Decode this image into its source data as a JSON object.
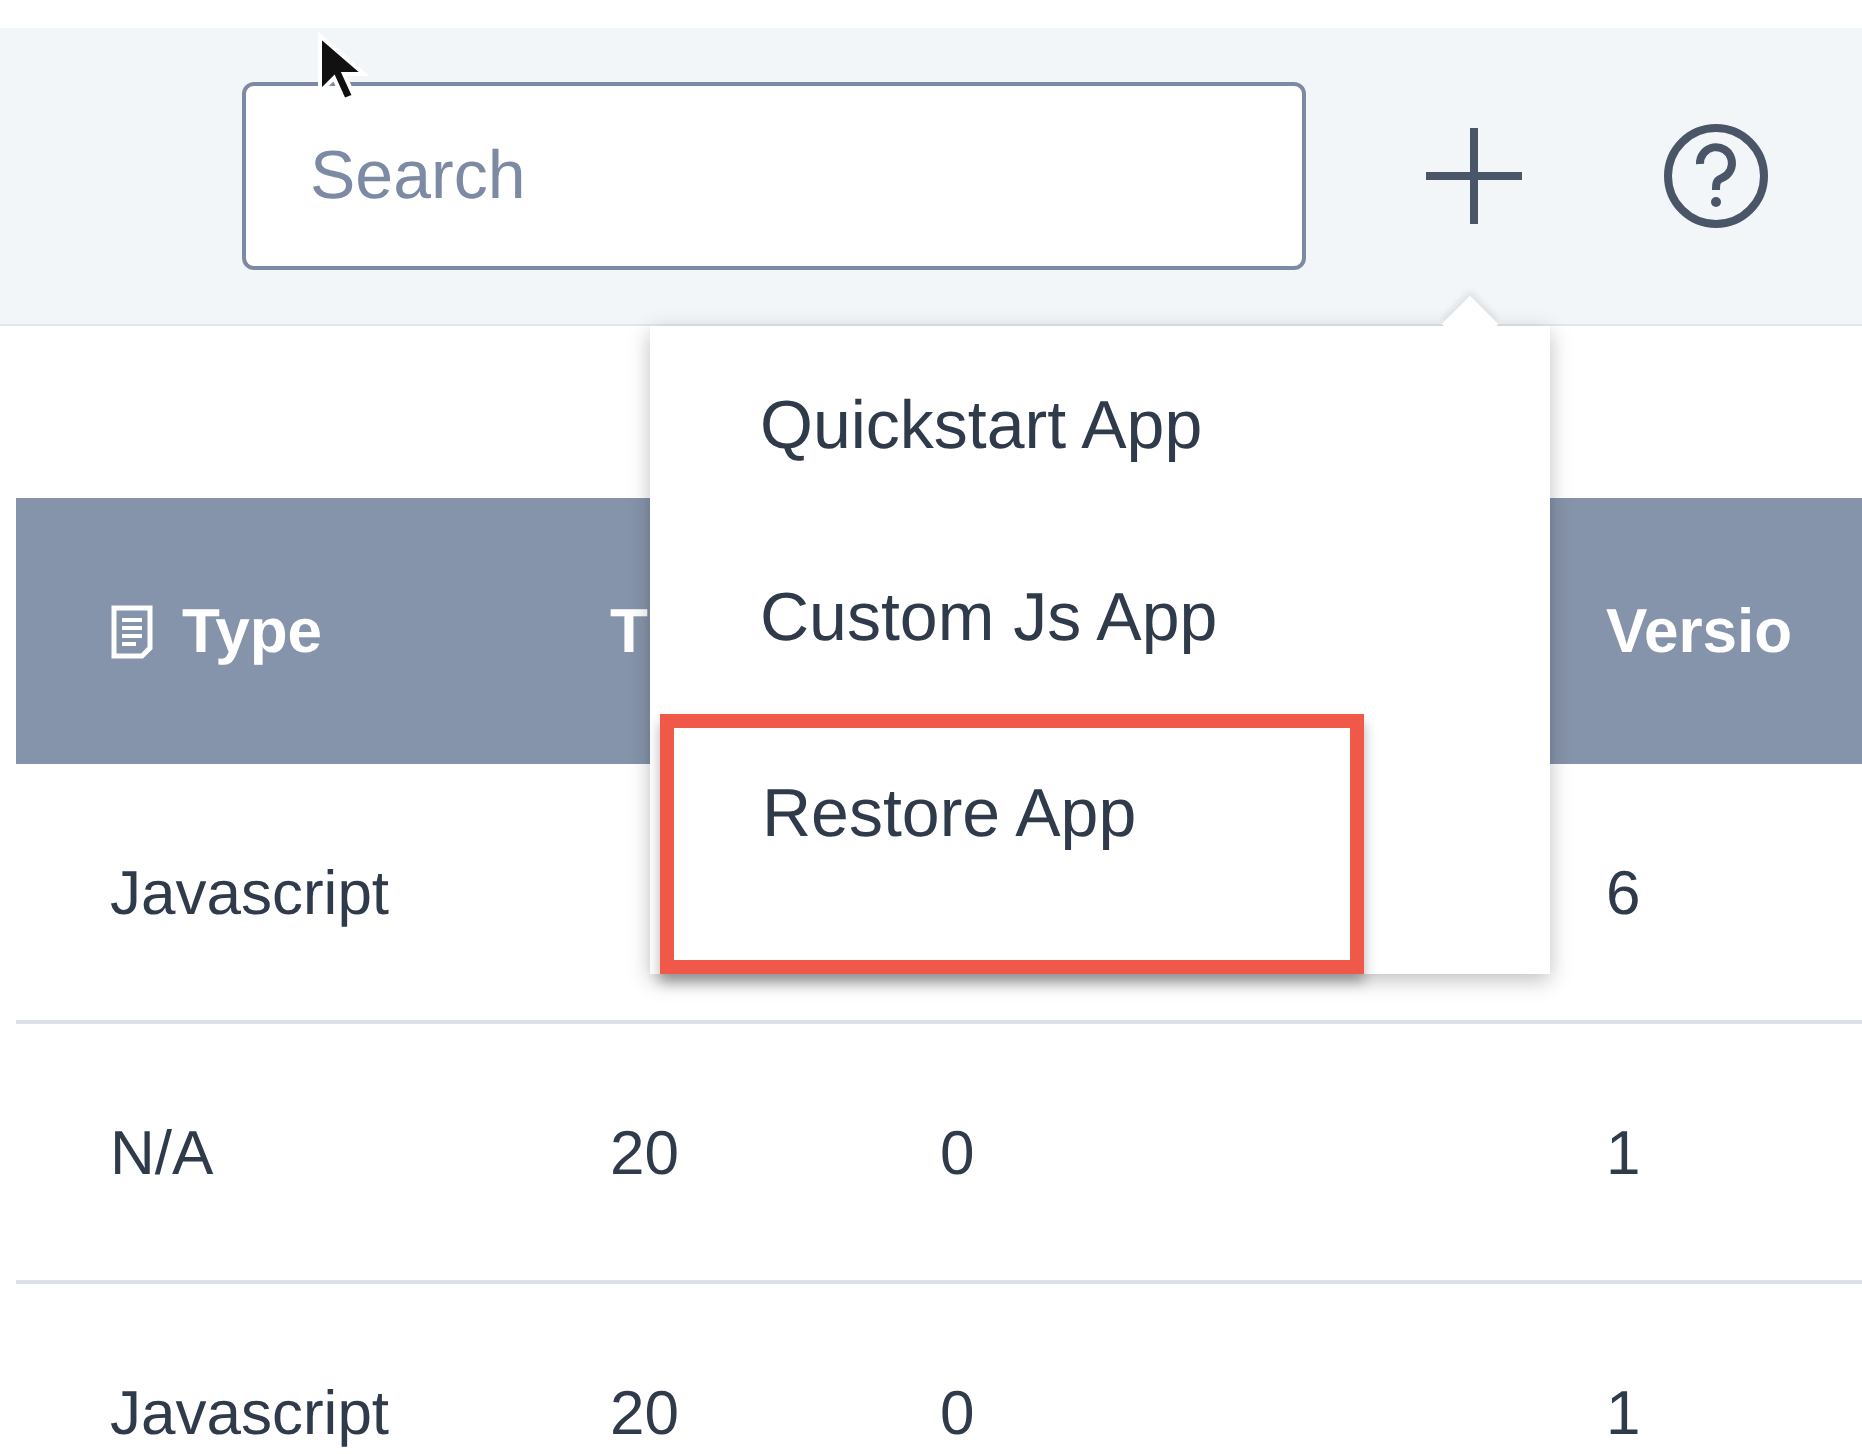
{
  "toolbar": {
    "search": {
      "placeholder": "Search"
    }
  },
  "add_menu": {
    "items": [
      {
        "label": "Quickstart App",
        "highlighted": false
      },
      {
        "label": "Custom Js App",
        "highlighted": false
      },
      {
        "label": "Restore App",
        "highlighted": true
      }
    ]
  },
  "table": {
    "columns": [
      {
        "label": "Type",
        "icon": true
      },
      {
        "label": "T"
      },
      {},
      {
        "label": "Versio"
      }
    ],
    "rows": [
      {
        "cells": [
          "Javascript",
          null,
          null,
          "6"
        ]
      },
      {
        "cells": [
          "N/A",
          "20",
          "0",
          "1"
        ]
      },
      {
        "cells": [
          "Javascript",
          "20",
          "0",
          "1"
        ]
      }
    ]
  }
}
